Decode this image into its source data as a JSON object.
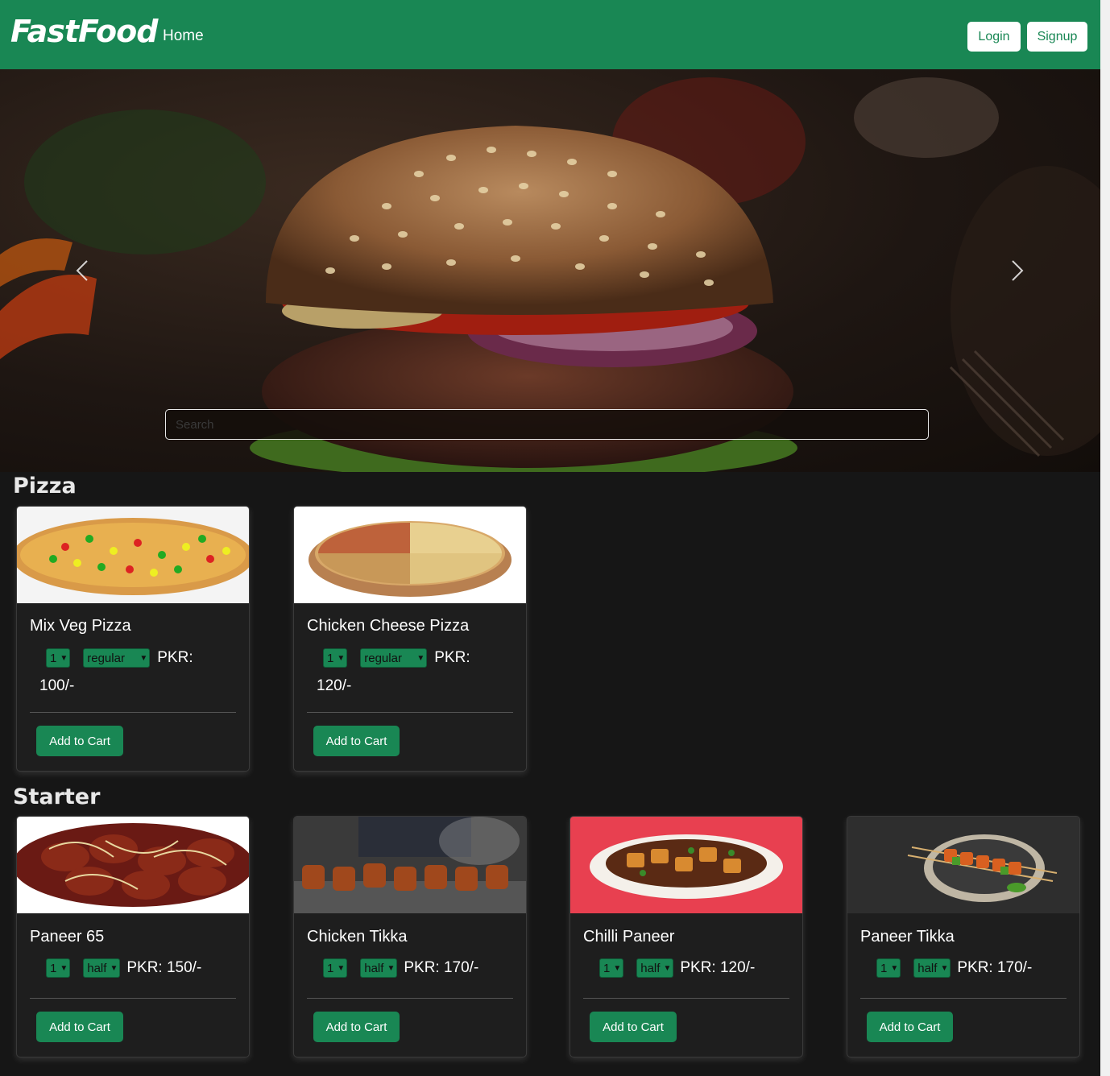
{
  "navbar": {
    "brand": "FastFood",
    "home_label": "Home",
    "login_label": "Login",
    "signup_label": "Signup",
    "bg_color": "#198754"
  },
  "hero": {
    "search_placeholder": "Search",
    "prev_icon": "chevron-left-icon",
    "next_icon": "chevron-right-icon"
  },
  "sections": [
    {
      "title": "Pizza",
      "items": [
        {
          "name": "Mix Veg Pizza",
          "qty": "1",
          "size": "regular",
          "price_prefix": "PKR:",
          "price_value": "100/-",
          "button": "Add to Cart"
        },
        {
          "name": "Chicken Cheese Pizza",
          "qty": "1",
          "size": "regular",
          "price_prefix": "PKR:",
          "price_value": "120/-",
          "button": "Add to Cart"
        }
      ]
    },
    {
      "title": "Starter",
      "items": [
        {
          "name": "Paneer 65",
          "qty": "1",
          "size": "half",
          "price": "PKR: 150/-",
          "button": "Add to Cart"
        },
        {
          "name": "Chicken Tikka",
          "qty": "1",
          "size": "half",
          "price": "PKR: 170/-",
          "button": "Add to Cart"
        },
        {
          "name": "Chilli Paneer",
          "qty": "1",
          "size": "half",
          "price": "PKR: 120/-",
          "button": "Add to Cart"
        },
        {
          "name": "Paneer Tikka",
          "qty": "1",
          "size": "half",
          "price": "PKR: 170/-",
          "button": "Add to Cart"
        }
      ]
    }
  ]
}
